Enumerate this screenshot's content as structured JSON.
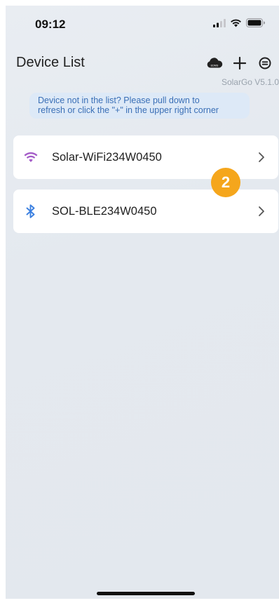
{
  "status_bar": {
    "time": "09:12",
    "icons": [
      "signal-icon",
      "wifi-icon",
      "battery-icon"
    ]
  },
  "header": {
    "title": "Device List",
    "actions": [
      "cloud-icon",
      "add-icon",
      "menu-icon"
    ],
    "cloud_label": "EDMS"
  },
  "app": {
    "version": "SolarGo V5.1.0"
  },
  "hint": {
    "line1": "Device not in the list? Please pull down to",
    "line2": "refresh or click the \"+\" in the upper right corner"
  },
  "devices": [
    {
      "name": "Solar-WiFi234W0450",
      "type": "wifi",
      "icon": "wifi-icon"
    },
    {
      "name": "SOL-BLE234W0450",
      "type": "bluetooth",
      "icon": "bluetooth-icon"
    }
  ],
  "annotation": {
    "badge": "2"
  },
  "colors": {
    "background": "#e4e9ef",
    "hint_bg": "#dde9f7",
    "hint_text": "#3a6fb6",
    "wifi_icon": "#a45cc8",
    "bluetooth_icon": "#3a7fe0",
    "badge": "#f5a61c"
  }
}
